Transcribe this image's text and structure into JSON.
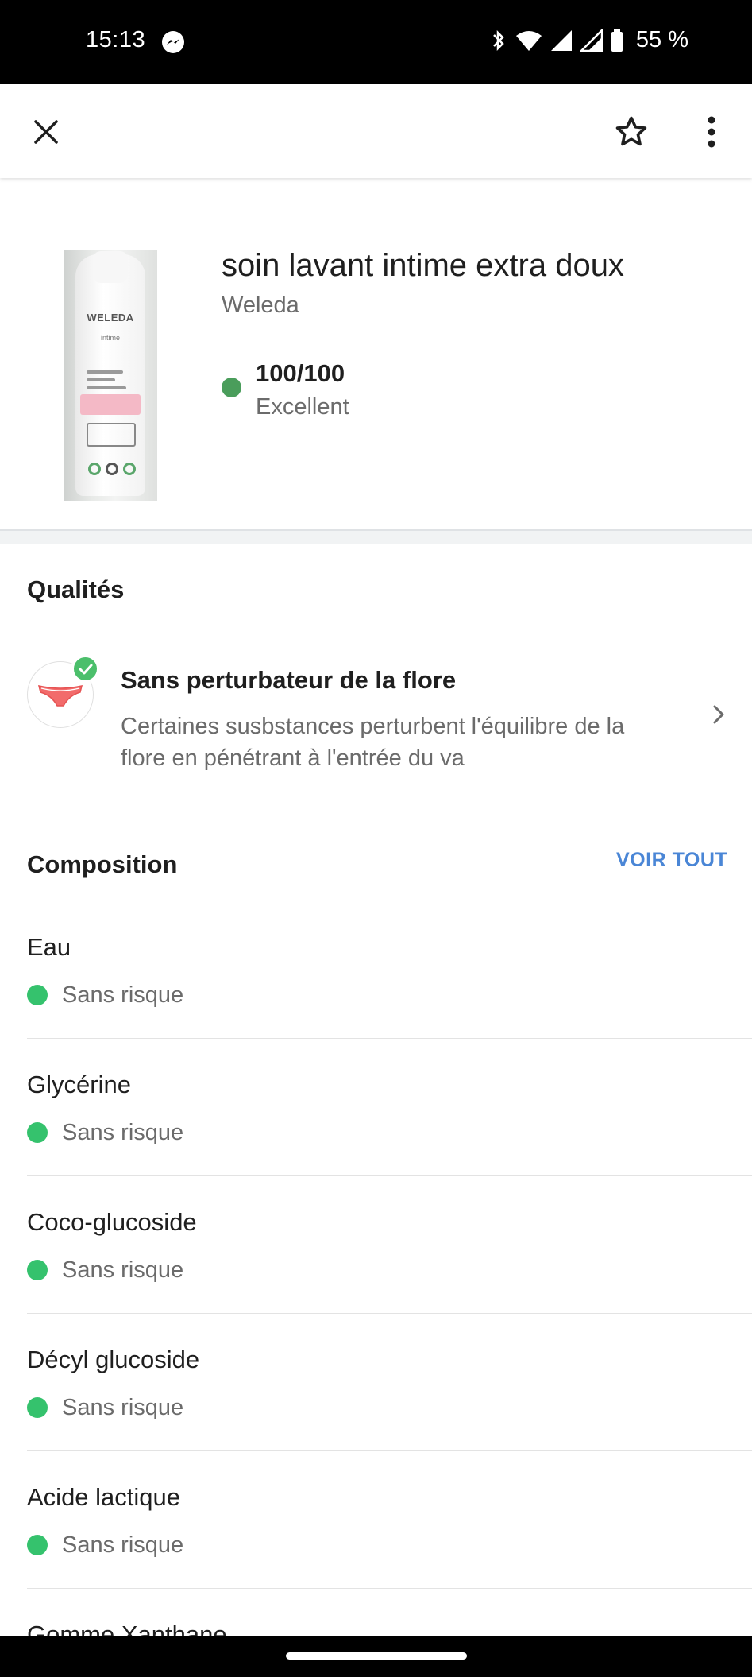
{
  "status_bar": {
    "time": "15:13",
    "battery": "55 %"
  },
  "app_bar": {
    "close_icon": "close-icon",
    "favorite_icon": "star-outline-icon",
    "more_icon": "more-vert-icon"
  },
  "product": {
    "title": "soin lavant intime extra doux",
    "brand": "Weleda",
    "score": "100/100",
    "score_label": "Excellent",
    "score_color": "#4a9d5b",
    "image_brand_text": "WELEDA",
    "image_sub_text": "intime"
  },
  "qualites": {
    "title": "Qualités",
    "items": [
      {
        "title": "Sans perturbateur de la flore",
        "description": "Certaines susbstances perturbent l'équilibre de la flore en pénétrant à l'entrée du va",
        "icon": "underwear-icon"
      }
    ]
  },
  "composition": {
    "title": "Composition",
    "see_all": "VOIR TOUT",
    "accent_color": "#4a86d6",
    "ingredients": [
      {
        "name": "Eau",
        "risk": "Sans risque"
      },
      {
        "name": "Glycérine",
        "risk": "Sans risque"
      },
      {
        "name": "Coco-glucoside",
        "risk": "Sans risque"
      },
      {
        "name": "Décyl glucoside",
        "risk": "Sans risque"
      },
      {
        "name": "Acide lactique",
        "risk": "Sans risque"
      },
      {
        "name": "Gomme Xanthane",
        "risk": ""
      }
    ],
    "risk_color": "#35c26d"
  }
}
